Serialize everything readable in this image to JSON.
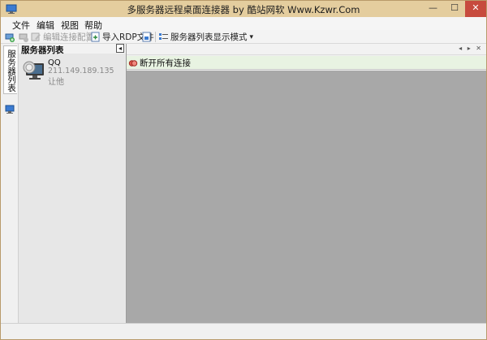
{
  "window": {
    "title": "多服务器远程桌面连接器 by 酷站网软 Www.Kzwr.Com",
    "min_label": "—",
    "max_label": "☐",
    "close_label": "✕"
  },
  "menu": {
    "items": [
      "文件",
      "编辑",
      "视图",
      "帮助"
    ]
  },
  "toolbar": {
    "edit_config_label": "编辑连接配置",
    "import_rdp_label": "导入RDP文件",
    "display_mode_label": "服务器列表显示模式",
    "dropdown_arrow": "▾"
  },
  "sidebar": {
    "tab_label": "服务器列表"
  },
  "server_panel": {
    "title": "服务器列表",
    "pin_glyph": "◂",
    "servers": [
      {
        "name": "QQ",
        "ip": "211.149.189.135",
        "group": "让他"
      }
    ]
  },
  "session_area": {
    "disconnect_all_label": "断开所有连接",
    "nav_glyphs": "◂ ▸ ✕"
  },
  "colors": {
    "titlebar": "#e4cd9e",
    "close_button": "#c74b3e",
    "workspace": "#a8a8a8",
    "action_bar": "#e8f3e2"
  }
}
